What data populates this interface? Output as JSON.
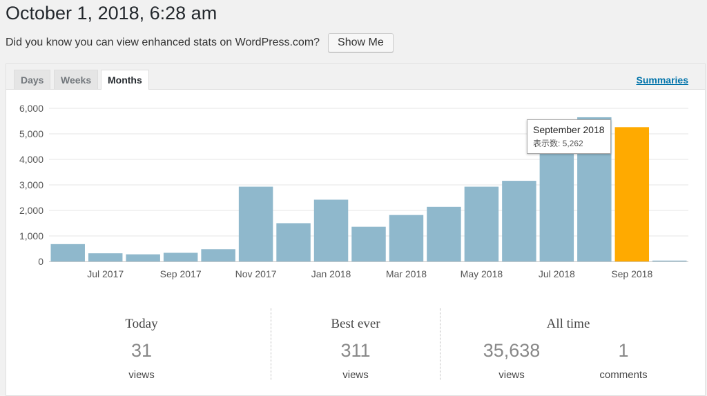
{
  "page": {
    "title": "October 1, 2018, 6:28 am",
    "promo_text": "Did you know you can view enhanced stats on WordPress.com?",
    "show_me_label": "Show Me"
  },
  "tabs": [
    {
      "label": "Days",
      "active": false
    },
    {
      "label": "Weeks",
      "active": false
    },
    {
      "label": "Months",
      "active": true
    }
  ],
  "summaries_label": "Summaries",
  "colors": {
    "bar": "#8fb8cc",
    "highlight": "#ffaa00",
    "grid": "#e4e4e4",
    "axis": "#555555",
    "link": "#0073aa"
  },
  "tooltip": {
    "title": "September 2018",
    "value_text": "表示数: 5,262"
  },
  "chart_data": {
    "type": "bar",
    "categories": [
      "Jun 2017",
      "Jul 2017",
      "Aug 2017",
      "Sep 2017",
      "Oct 2017",
      "Nov 2017",
      "Dec 2017",
      "Jan 2018",
      "Feb 2018",
      "Mar 2018",
      "Apr 2018",
      "May 2018",
      "Jun 2018",
      "Jul 2018",
      "Aug 2018",
      "Sep 2018",
      "Oct 2018"
    ],
    "tick_labels": [
      "",
      "Jul 2017",
      "",
      "Sep 2017",
      "",
      "Nov 2017",
      "",
      "Jan 2018",
      "",
      "Mar 2018",
      "",
      "May 2018",
      "",
      "Jul 2018",
      "",
      "Sep 2018",
      ""
    ],
    "values": [
      680,
      320,
      280,
      340,
      480,
      2930,
      1500,
      2420,
      1360,
      1820,
      2140,
      2930,
      3160,
      4400,
      5650,
      5262,
      35
    ],
    "highlight_index": 15,
    "ylim": [
      0,
      6000
    ],
    "yticks": [
      0,
      1000,
      2000,
      3000,
      4000,
      5000,
      6000
    ],
    "ytick_labels": [
      "0",
      "1,000",
      "2,000",
      "3,000",
      "4,000",
      "5,000",
      "6,000"
    ],
    "grid": true
  },
  "stats": {
    "today": {
      "heading": "Today",
      "value": "31",
      "label": "views"
    },
    "best_ever": {
      "heading": "Best ever",
      "value": "311",
      "label": "views"
    },
    "all_time": {
      "heading": "All time",
      "views_value": "35,638",
      "views_label": "views",
      "comments_value": "1",
      "comments_label": "comments"
    }
  }
}
